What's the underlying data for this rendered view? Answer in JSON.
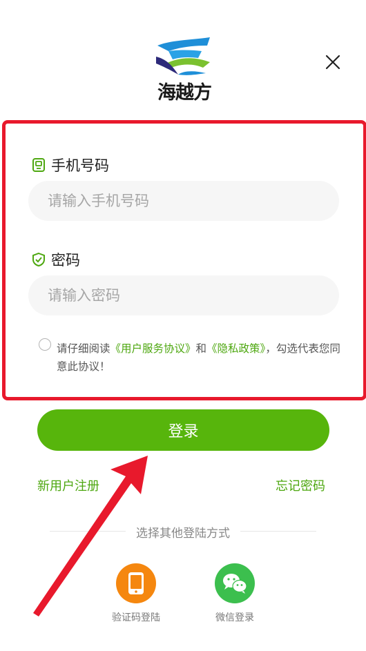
{
  "brand": {
    "name": "海越方"
  },
  "phone": {
    "label": "手机号码",
    "placeholder": "请输入手机号码",
    "value": ""
  },
  "password": {
    "label": "密码",
    "placeholder": "请输入密码",
    "value": ""
  },
  "agreement": {
    "prefix": "请仔细阅读",
    "user_agreement": "《用户服务协议》",
    "and": "和",
    "privacy_policy": "《隐私政策》",
    "suffix": "，勾选代表您同意此协议！",
    "checked": false
  },
  "login_button": "登录",
  "register_link": "新用户注册",
  "forgot_link": "忘记密码",
  "other_methods": {
    "title": "选择其他登陆方式",
    "items": [
      {
        "label": "验证码登陆",
        "icon": "phone-icon",
        "color": "#f5870f"
      },
      {
        "label": "微信登录",
        "icon": "wechat-icon",
        "color": "#3cbf4e"
      }
    ]
  },
  "colors": {
    "accent": "#57b50c",
    "link": "#4da70f",
    "highlight": "#e8192c"
  }
}
